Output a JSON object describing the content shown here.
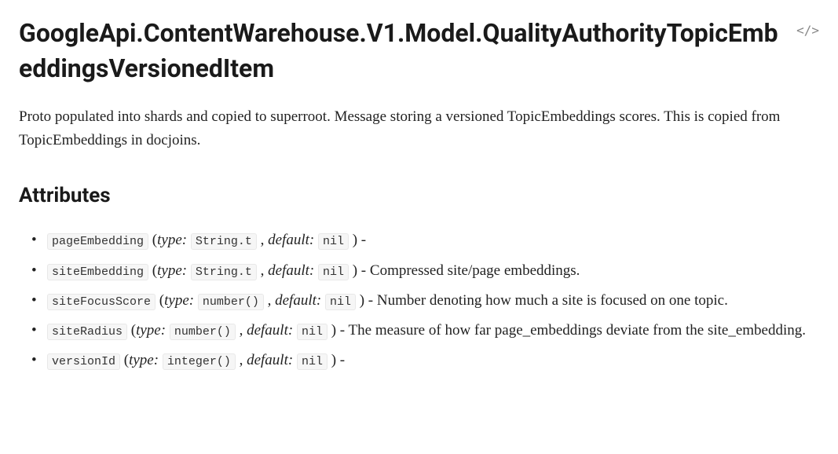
{
  "title": "GoogleApi.ContentWarehouse.V1.Model.QualityAuthorityTopicEmbeddingsVersionedItem",
  "sourceLinkLabel": "</>",
  "description": "Proto populated into shards and copied to superroot. Message storing a versioned TopicEmbeddings scores. This is copied from TopicEmbeddings in docjoins.",
  "attributesHeading": "Attributes",
  "typeLabel": "type:",
  "defaultLabel": "default:",
  "attributes": [
    {
      "name": "pageEmbedding",
      "type": "String.t",
      "default": "nil",
      "desc": ""
    },
    {
      "name": "siteEmbedding",
      "type": "String.t",
      "default": "nil",
      "desc": "Compressed site/page embeddings."
    },
    {
      "name": "siteFocusScore",
      "type": "number()",
      "default": "nil",
      "desc": "Number denoting how much a site is focused on one topic."
    },
    {
      "name": "siteRadius",
      "type": "number()",
      "default": "nil",
      "desc": "The measure of how far page_embeddings deviate from the site_embedding."
    },
    {
      "name": "versionId",
      "type": "integer()",
      "default": "nil",
      "desc": ""
    }
  ]
}
